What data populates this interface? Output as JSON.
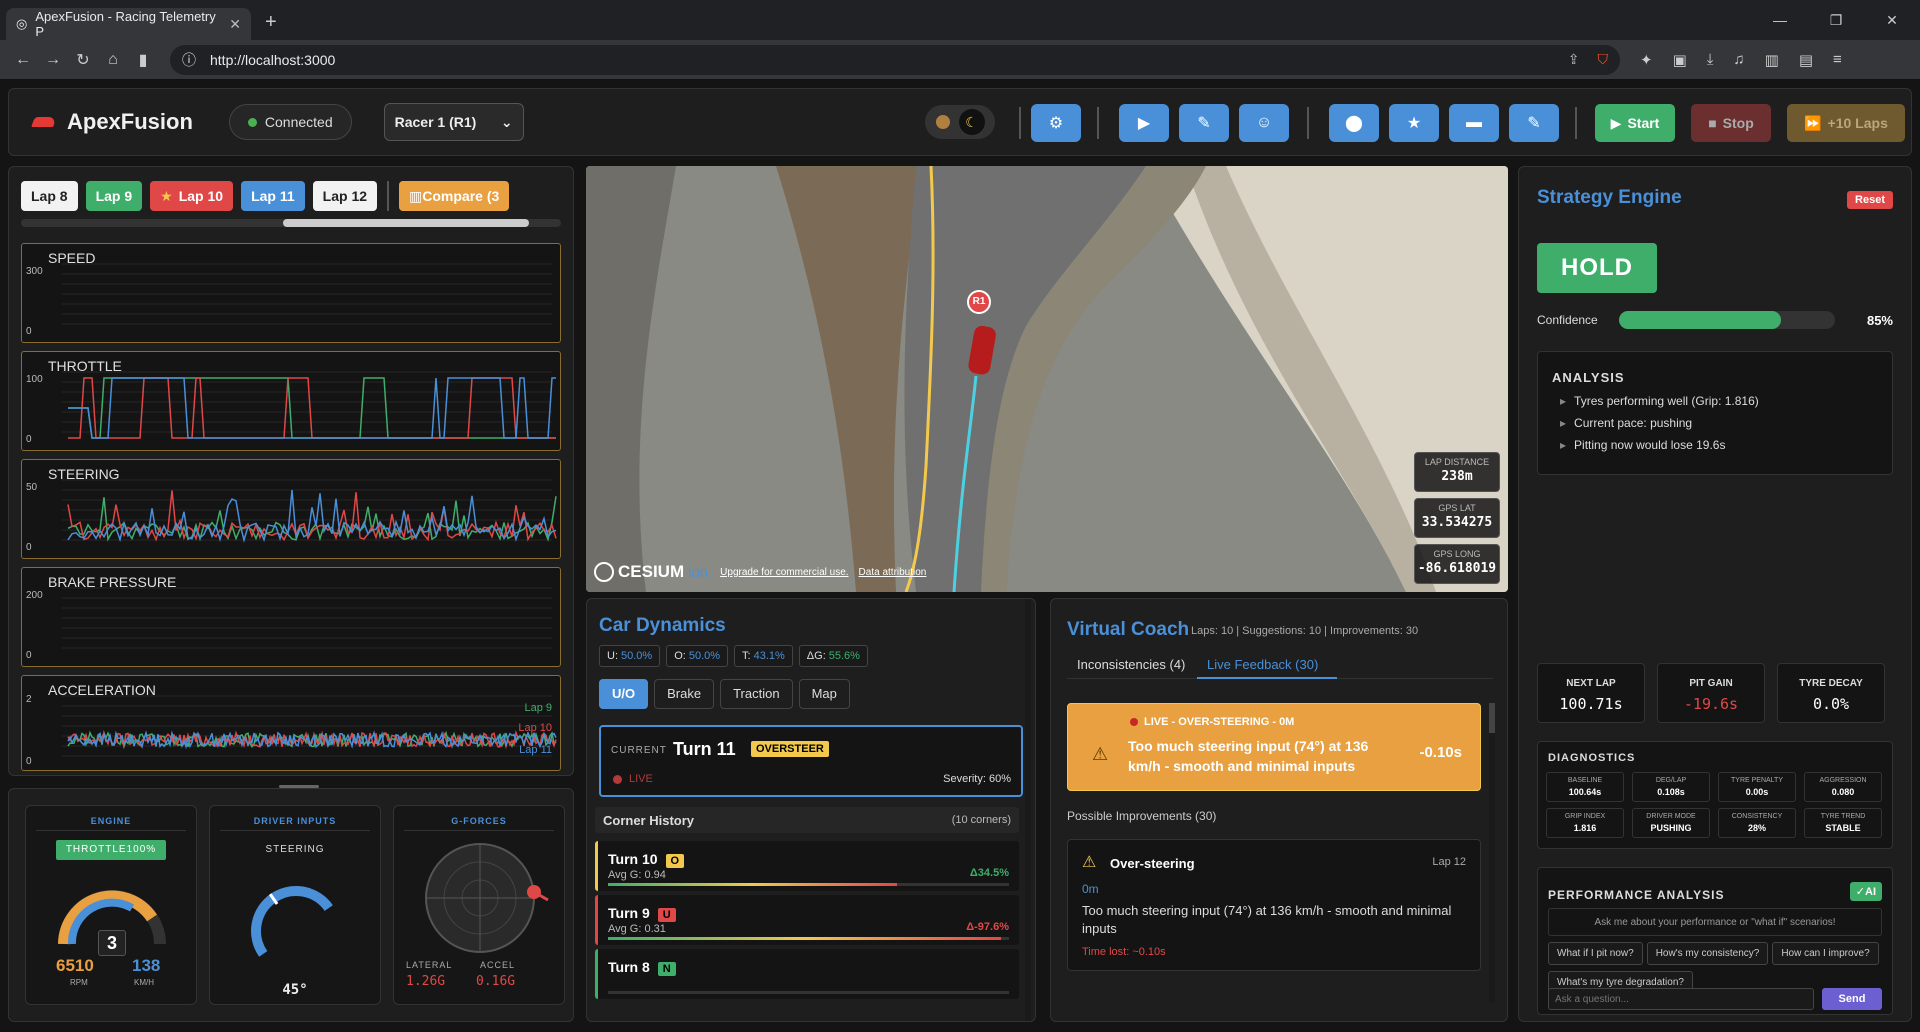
{
  "browser": {
    "tab_title": "ApexFusion - Racing Telemetry P",
    "url": "http://localhost:3000"
  },
  "header": {
    "app_name": "ApexFusion",
    "status": "Connected",
    "racer_select": "Racer 1 (R1)",
    "start_label": "Start",
    "stop_label": "Stop",
    "plus_laps_label": "+10 Laps",
    "accent": "#4a90d9"
  },
  "laps": {
    "tabs": [
      {
        "label": "Lap 8",
        "bg": "#f2f2f2",
        "fg": "#222"
      },
      {
        "label": "Lap 9",
        "bg": "#3fae6b",
        "fg": "#fff"
      },
      {
        "label": "Lap 10",
        "bg": "#e04848",
        "fg": "#fff",
        "star": "★"
      },
      {
        "label": "Lap 11",
        "bg": "#4a90d9",
        "fg": "#fff"
      },
      {
        "label": "Lap 12",
        "bg": "#f2f2f2",
        "fg": "#222"
      }
    ],
    "compare_label": "Compare (3"
  },
  "charts": {
    "speed": {
      "title": "SPEED",
      "ymax": "300",
      "ymin": "0"
    },
    "throttle": {
      "title": "THROTTLE",
      "ymax": "100",
      "ymin": "0"
    },
    "steering": {
      "title": "STEERING",
      "ymax": "50",
      "ymin": "0"
    },
    "brake": {
      "title": "BRAKE PRESSURE",
      "ymax": "200",
      "ymin": "0"
    },
    "accel": {
      "title": "ACCELERATION",
      "ymax": "2",
      "ymin": "0"
    },
    "legend": {
      "lap9": "Lap 9",
      "lap10": "Lap 10",
      "lap11": "Lap 11"
    },
    "colors": {
      "lap9": "#3fae6b",
      "lap10": "#e04848",
      "lap11": "#4a90d9"
    }
  },
  "gauges": {
    "engine": {
      "title": "ENGINE",
      "throttle": "THROTTLE100%",
      "gear": "3",
      "rpm": "6510",
      "rpm_label": "RPM",
      "speed": "138",
      "speed_label": "KM/H"
    },
    "driver": {
      "title": "DRIVER INPUTS",
      "steering_label": "STEERING",
      "steering_value": "45°"
    },
    "gforces": {
      "title": "G-FORCES",
      "lateral_label": "LATERAL",
      "accel_label": "ACCEL",
      "lateral": "1.26G",
      "accel": "0.16G"
    }
  },
  "map": {
    "marker": "R1",
    "cesium": "CESIUM",
    "cesium_ion": "ion",
    "upgrade": "Upgrade for commercial use.",
    "attribution": "Data attribution",
    "lap_distance_label": "LAP DISTANCE",
    "lap_distance": "238m",
    "gps_lat_label": "GPS LAT",
    "gps_lat": "33.534275",
    "gps_long_label": "GPS LONG",
    "gps_long": "-86.618019"
  },
  "car_dynamics": {
    "title": "Car Dynamics",
    "pills": [
      {
        "k": "U:",
        "v": "50.0%",
        "c": "#4a90d9"
      },
      {
        "k": "O:",
        "v": "50.0%",
        "c": "#4a90d9"
      },
      {
        "k": "T:",
        "v": "43.1%",
        "c": "#4a90d9"
      },
      {
        "k": "ΔG:",
        "v": "55.6%",
        "c": "#3fae6b"
      }
    ],
    "tabs": [
      "U/O",
      "Brake",
      "Traction",
      "Map"
    ],
    "current_label": "CURRENT",
    "current_turn": "Turn 11",
    "current_badge": "OVERSTEER",
    "live_label": "LIVE",
    "severity": "Severity: 60%",
    "history_label": "Corner History",
    "history_count": "(10 corners)",
    "corners": [
      {
        "name": "Turn 10",
        "badge": "O",
        "badge_bg": "#f2c94c",
        "avg": "Avg G: 0.94",
        "delta": "Δ34.5%",
        "delta_color": "#3fae6b",
        "fill": 0.72
      },
      {
        "name": "Turn 9",
        "badge": "U",
        "badge_bg": "#e04848",
        "avg": "Avg G: 0.31",
        "delta": "Δ-97.6%",
        "delta_color": "#e04848",
        "fill": 0.98
      },
      {
        "name": "Turn 8",
        "badge": "N",
        "badge_bg": "#3fae6b",
        "avg": "",
        "delta": "",
        "delta_color": "#e04848",
        "fill": 0.0
      }
    ]
  },
  "coach": {
    "title": "Virtual Coach",
    "meta": "Laps: 10 | Suggestions: 10 | Improvements: 30",
    "tab_inconsistencies": "Inconsistencies (4)",
    "tab_live": "Live Feedback (30)",
    "alert_head": "LIVE - OVER-STEERING - 0M",
    "alert_text": "Too much steering input (74°) at 136 km/h - smooth and minimal inputs",
    "alert_delta": "-0.10s",
    "improvements_label": "Possible Improvements (30)",
    "item_title": "Over-steering",
    "item_lap": "Lap 12",
    "item_dist": "0m",
    "item_text": "Too much steering input (74°) at 136 km/h - smooth and minimal inputs",
    "item_lost": "Time lost: ~0.10s"
  },
  "strategy": {
    "title": "Strategy Engine",
    "reset": "Reset",
    "decision": "HOLD",
    "confidence_label": "Confidence",
    "confidence": 0.85,
    "confidence_text": "85%",
    "analysis_title": "ANALYSIS",
    "analysis": [
      "Tyres performing well (Grip: 1.816)",
      "Current pace: pushing",
      "Pitting now would lose 19.6s"
    ],
    "next_lap_label": "NEXT LAP",
    "next_lap": "100.71s",
    "pit_gain_label": "PIT GAIN",
    "pit_gain": "-19.6s",
    "tyre_decay_label": "TYRE DECAY",
    "tyre_decay": "0.0%",
    "diagnostics_title": "DIAGNOSTICS",
    "diagnostics": [
      {
        "l": "BASELINE",
        "v": "100.64s"
      },
      {
        "l": "DEG/LAP",
        "v": "0.108s"
      },
      {
        "l": "TYRE PENALTY",
        "v": "0.00s"
      },
      {
        "l": "AGGRESSION",
        "v": "0.080"
      },
      {
        "l": "GRIP INDEX",
        "v": "1.816"
      },
      {
        "l": "DRIVER MODE",
        "v": "PUSHING"
      },
      {
        "l": "CONSISTENCY",
        "v": "28%"
      },
      {
        "l": "TYRE TREND",
        "v": "STABLE"
      }
    ],
    "perf_title": "PERFORMANCE ANALYSIS",
    "ai_badge": "✓AI",
    "perf_placeholder": "Ask me about your performance or \"what if\" scenarios!",
    "questions": [
      "What if I pit now?",
      "How's my consistency?",
      "How can I improve?",
      "What's my tyre degradation?"
    ],
    "input_placeholder": "Ask a question...",
    "send": "Send"
  }
}
